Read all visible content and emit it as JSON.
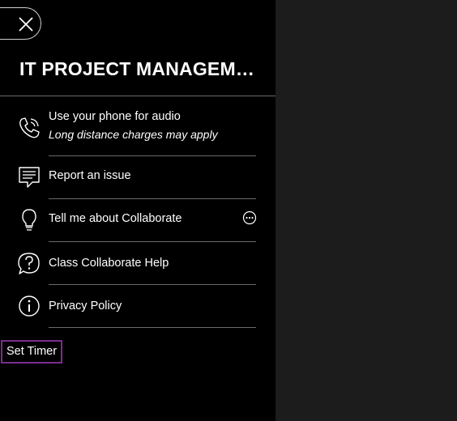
{
  "panel": {
    "title": "IT PROJECT MANAGEMENT",
    "close_icon": "close-icon"
  },
  "menu": {
    "phone": {
      "label": "Use your phone for audio",
      "sub": "Long distance charges may apply",
      "icon": "phone-icon"
    },
    "report": {
      "label": "Report an issue",
      "icon": "chat-message-icon"
    },
    "tell": {
      "label": "Tell me about Collaborate",
      "icon": "lightbulb-icon",
      "more_icon": "more-options-icon"
    },
    "help": {
      "label": "Class Collaborate Help",
      "icon": "help-question-icon"
    },
    "privacy": {
      "label": "Privacy Policy",
      "icon": "info-icon"
    }
  },
  "timer": {
    "label": "Set Timer"
  },
  "colors": {
    "panel_bg": "#000000",
    "page_bg": "#1c1c1c",
    "focus_outline": "#7b2d8e",
    "divider": "#6a6a6a"
  }
}
